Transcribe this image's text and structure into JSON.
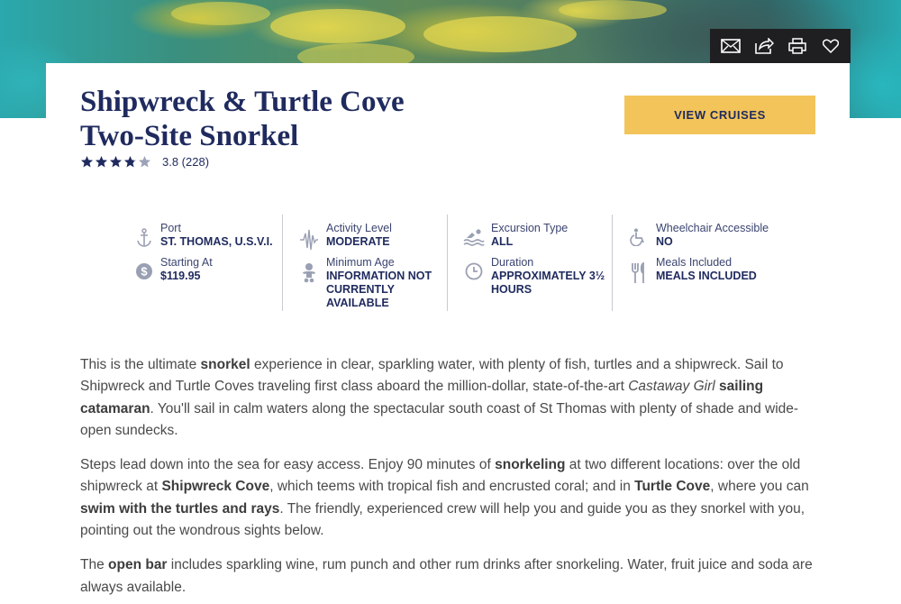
{
  "header": {
    "icons": [
      {
        "icon": "mail-icon",
        "name": "email-share-button"
      },
      {
        "icon": "share-icon",
        "name": "share-button"
      },
      {
        "icon": "print-icon",
        "name": "print-button"
      },
      {
        "icon": "heart-icon",
        "name": "favorite-button"
      }
    ]
  },
  "excursion": {
    "title": "Shipwreck & Turtle Cove Two-Site Snorkel",
    "rating": 3.8,
    "rating_text": "3.8 (228)",
    "cta_label": "VIEW CRUISES"
  },
  "facts": {
    "port": {
      "label": "Port",
      "value": "ST. THOMAS, U.S.V.I.",
      "icon": "anchor-icon"
    },
    "starting_at": {
      "label": "Starting At",
      "value": "$119.95",
      "icon": "dollar-icon"
    },
    "activity_level": {
      "label": "Activity Level",
      "value": "MODERATE",
      "icon": "activity-icon"
    },
    "minimum_age": {
      "label": "Minimum Age",
      "value": "INFORMATION NOT CURRENTLY AVAILABLE",
      "icon": "baby-icon"
    },
    "excursion_type": {
      "label": "Excursion Type",
      "value": "ALL",
      "icon": "swimmer-icon"
    },
    "duration": {
      "label": "Duration",
      "value": "APPROXIMATELY 3½ HOURS",
      "icon": "clock-icon"
    },
    "wheelchair": {
      "label": "Wheelchair Accessible",
      "value": "NO",
      "icon": "wheelchair-icon"
    },
    "meals": {
      "label": "Meals Included",
      "value": "MEALS INCLUDED",
      "icon": "utensils-icon"
    }
  },
  "description": {
    "p1": {
      "t1": "This is the ultimate ",
      "b1": "snorkel",
      "t2": " experience in clear, sparkling water, with plenty of fish, turtles and a shipwreck. Sail to Shipwreck and Turtle Coves traveling first class aboard the million-dollar, state-of-the-art ",
      "i1": "Castaway Girl",
      "t3": " ",
      "b2": "sailing catamaran",
      "t4": ". You'll sail in calm waters along the spectacular south coast of St Thomas with plenty of shade and wide-open sundecks."
    },
    "p2": {
      "t1": "Steps lead down into the sea for easy access. Enjoy 90 minutes of ",
      "b1": "snorkeling",
      "t2": " at two different locations: over the old shipwreck at ",
      "b2": "Shipwreck Cove",
      "t3": ", which teems with tropical fish and encrusted coral; and in ",
      "b3": "Turtle Cove",
      "t4": ", where you can ",
      "b4": "swim with the turtles and rays",
      "t5": ". The friendly, experienced crew will help you and guide you as they snorkel with you, pointing out the wondrous sights below."
    },
    "p3": {
      "t1": "The ",
      "b1": "open bar",
      "t2": " includes sparkling wine, rum punch and other rum drinks after snorkeling. Water, fruit juice and soda are always available."
    }
  }
}
